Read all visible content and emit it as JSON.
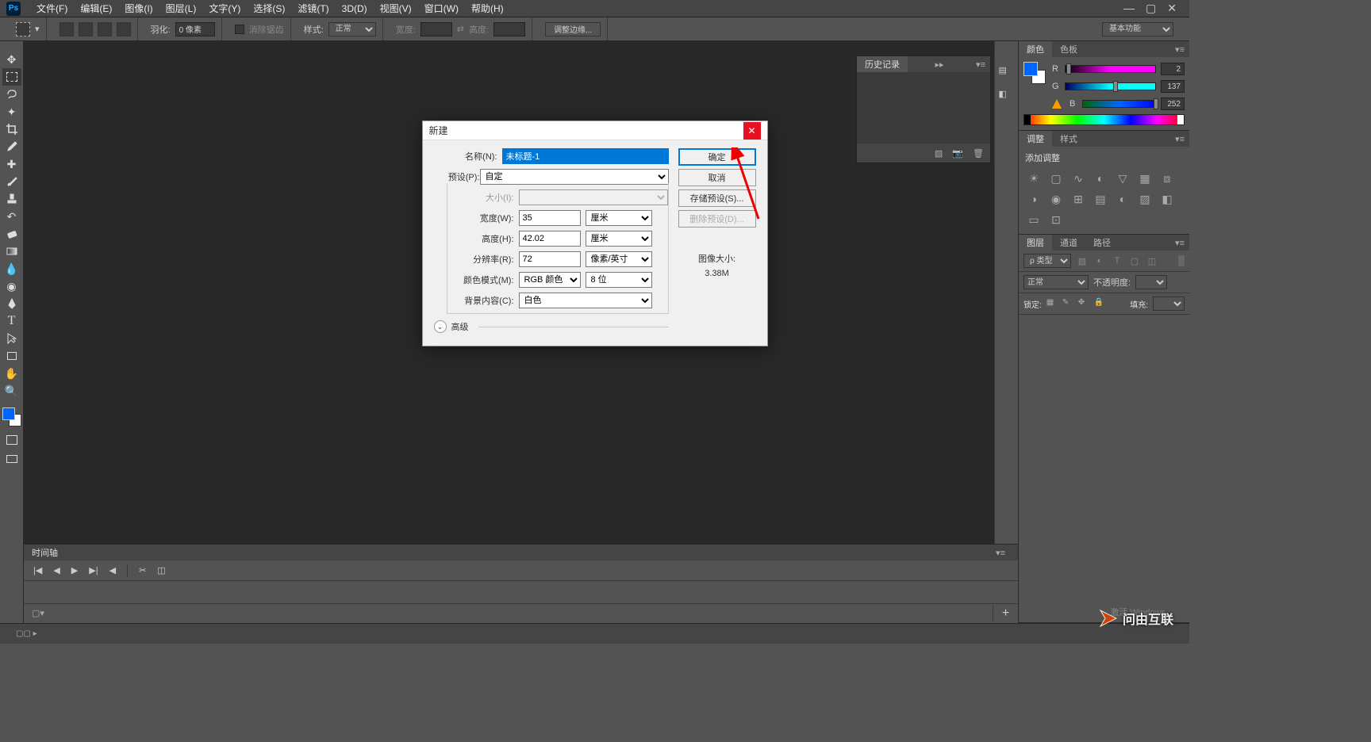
{
  "app": {
    "logo": "Ps"
  },
  "menubar": [
    "文件(F)",
    "编辑(E)",
    "图像(I)",
    "图层(L)",
    "文字(Y)",
    "选择(S)",
    "滤镜(T)",
    "3D(D)",
    "视图(V)",
    "窗口(W)",
    "帮助(H)"
  ],
  "optionsbar": {
    "feather_label": "羽化:",
    "feather_value": "0 像素",
    "antialias_label": "消除锯齿",
    "style_label": "样式:",
    "style_value": "正常",
    "width_label": "宽度:",
    "height_label": "高度:",
    "refine_label": "调整边缘...",
    "workspace_label": "基本功能"
  },
  "dialog": {
    "title": "新建",
    "labels": {
      "name": "名称(N):",
      "preset": "预设(P):",
      "size": "大小(I):",
      "width": "宽度(W):",
      "height": "高度(H):",
      "resolution": "分辨率(R):",
      "color_mode": "颜色模式(M):",
      "background": "背景内容(C):",
      "advanced": "高级"
    },
    "values": {
      "name": "未标题-1",
      "preset": "自定",
      "width": "35",
      "width_unit": "厘米",
      "height": "42.02",
      "height_unit": "厘米",
      "resolution": "72",
      "resolution_unit": "像素/英寸",
      "color_mode": "RGB 颜色",
      "color_depth": "8 位",
      "background": "白色"
    },
    "buttons": {
      "ok": "确定",
      "cancel": "取消",
      "save_preset": "存储预设(S)...",
      "delete_preset": "删除预设(D)..."
    },
    "doc_size_label": "图像大小:",
    "doc_size_value": "3.38M"
  },
  "panels": {
    "history": {
      "tab": "历史记录"
    },
    "color": {
      "tabs": [
        "颜色",
        "色板"
      ],
      "r": {
        "label": "R",
        "value": "2"
      },
      "g": {
        "label": "G",
        "value": "137"
      },
      "b": {
        "label": "B",
        "value": "252"
      }
    },
    "adjustments": {
      "tabs": [
        "调整",
        "样式"
      ],
      "title": "添加调整"
    },
    "layers": {
      "tabs": [
        "图层",
        "通道",
        "路径"
      ],
      "filter_label": "ρ 类型",
      "mode": "正常",
      "opacity_label": "不透明度:",
      "lock_label": "锁定:",
      "fill_label": "填充:"
    }
  },
  "timeline": {
    "tab": "时间轴"
  },
  "watermark": "问由互联",
  "activate_hint": "激活 Windows"
}
